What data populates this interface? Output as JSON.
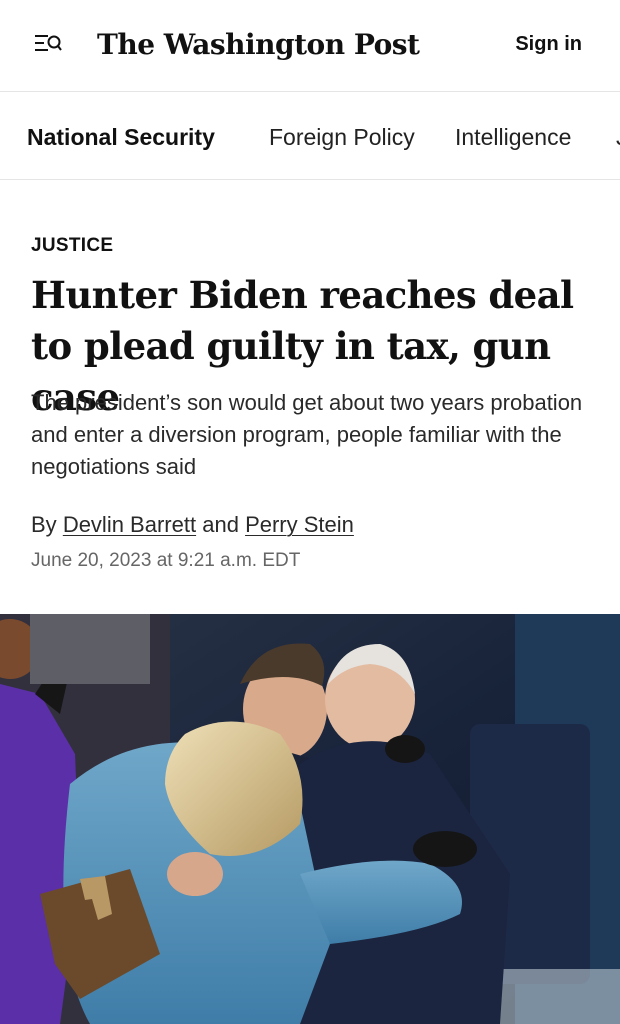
{
  "header": {
    "logo_text": "The Washington Post",
    "signin_label": "Sign in",
    "menu_icon": "menu-search-icon"
  },
  "section_nav": {
    "items": [
      {
        "label": "National Security",
        "active": true
      },
      {
        "label": "Foreign Policy",
        "active": false
      },
      {
        "label": "Intelligence",
        "active": false
      },
      {
        "label": "J",
        "active": false
      }
    ]
  },
  "article": {
    "kicker": "JUSTICE",
    "headline": "Hunter Biden reaches deal to plead guilty in tax, gun case",
    "dek": "The president’s son would get about two years probation and enter a diversion program, people familiar with the negotiations said",
    "byline_prefix": "By",
    "byline_conjunction": "and",
    "authors": [
      "Devlin Barrett",
      "Perry Stein"
    ],
    "timestamp": "June 20, 2023 at 9:21 a.m. EDT"
  },
  "lead_image": {
    "description_icon": "photo"
  },
  "colors": {
    "text": "#111111",
    "secondary_text": "#666666",
    "divider": "#e5e5e5"
  }
}
